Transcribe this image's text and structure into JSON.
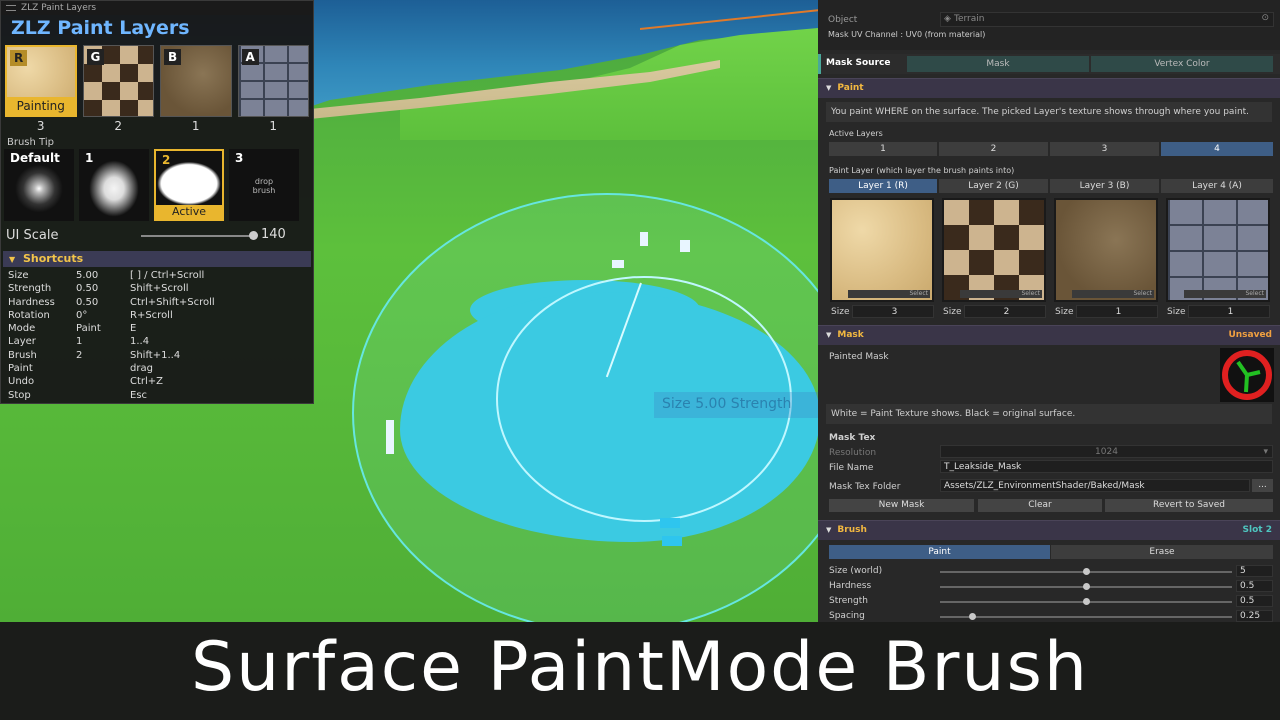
{
  "left_panel": {
    "window_title": "ZLZ Paint Layers",
    "title": "ZLZ Paint Layers",
    "layers": [
      {
        "letter": "R",
        "count": "3",
        "badge": "Painting"
      },
      {
        "letter": "G",
        "count": "2"
      },
      {
        "letter": "B",
        "count": "1"
      },
      {
        "letter": "A",
        "count": "1"
      }
    ],
    "brush_tip_label": "Brush Tip",
    "brush_tips": [
      {
        "label": "Default"
      },
      {
        "label": "1"
      },
      {
        "label": "2",
        "badge": "Active"
      },
      {
        "label": "3",
        "hint_line1": "drop",
        "hint_line2": "brush"
      }
    ],
    "ui_scale_label": "UI Scale",
    "ui_scale_value": "140",
    "shortcuts_title": "Shortcuts",
    "shortcuts": [
      {
        "name": "Size",
        "value": "5.00",
        "keys": "[ ] / Ctrl+Scroll"
      },
      {
        "name": "Strength",
        "value": "0.50",
        "keys": "Shift+Scroll"
      },
      {
        "name": "Hardness",
        "value": "0.50",
        "keys": "Ctrl+Shift+Scroll"
      },
      {
        "name": "Rotation",
        "value": "0°",
        "keys": "R+Scroll"
      },
      {
        "name": "Mode",
        "value": "Paint",
        "keys": "E"
      },
      {
        "name": "Layer",
        "value": "1",
        "keys": "1..4"
      },
      {
        "name": "Brush",
        "value": "2",
        "keys": "Shift+1..4"
      },
      {
        "name": "Paint",
        "value": "",
        "keys": "drag"
      },
      {
        "name": "Undo",
        "value": "",
        "keys": "Ctrl+Z"
      },
      {
        "name": "Stop",
        "value": "",
        "keys": "Esc"
      }
    ]
  },
  "scene": {
    "hud_ghost": "Size 5.00   Strength"
  },
  "inspector": {
    "object_label": "Object",
    "object_value": "Terrain",
    "mask_uv": "Mask UV Channel : UV0  (from material)",
    "mask_source_label": "Mask Source",
    "mask_source_options": [
      "Mask",
      "Vertex Color"
    ],
    "paint_header": "Paint",
    "paint_help": "You paint WHERE on the surface. The picked Layer's texture shows through where you paint.",
    "active_layers_label": "Active Layers",
    "active_layers": [
      "1",
      "2",
      "3",
      "4"
    ],
    "paint_layer_label": "Paint Layer (which layer the brush paints into)",
    "paint_layers": [
      "Layer 1 (R)",
      "Layer 2 (G)",
      "Layer 3 (B)",
      "Layer 4 (A)"
    ],
    "select_label": "Select",
    "size_label": "Size",
    "layer_sizes": [
      "3",
      "2",
      "1",
      "1"
    ],
    "mask_header": "Mask",
    "mask_status": "Unsaved",
    "painted_mask_label": "Painted Mask",
    "mask_help": "White = Paint Texture shows.   Black = original surface.",
    "mask_tex_label": "Mask Tex",
    "resolution_label": "Resolution",
    "resolution_value": "1024",
    "file_name_label": "File Name",
    "file_name_value": "T_Leakside_Mask",
    "folder_label": "Mask Tex Folder",
    "folder_value": "Assets/ZLZ_EnvironmentShader/Baked/Mask",
    "browse_label": "...",
    "new_mask": "New Mask",
    "clear": "Clear",
    "revert": "Revert to Saved",
    "brush_header": "Brush",
    "brush_slot": "Slot 2",
    "brush_modes": [
      "Paint",
      "Erase"
    ],
    "sliders": [
      {
        "label": "Size (world)",
        "value": "5",
        "fraction": 0.5
      },
      {
        "label": "Hardness",
        "value": "0.5",
        "fraction": 0.5
      },
      {
        "label": "Strength",
        "value": "0.5",
        "fraction": 0.5
      },
      {
        "label": "Spacing",
        "value": "0.25",
        "fraction": 0.11
      }
    ]
  },
  "caption": "Surface PaintMode Brush",
  "colors": {
    "accent_gold": "#e9b62e",
    "title_blue": "#6fb6ff",
    "mask_source_teal": "#4aa89a",
    "unsaved_orange": "#f0a040",
    "slot_teal": "#4ec6c0"
  }
}
